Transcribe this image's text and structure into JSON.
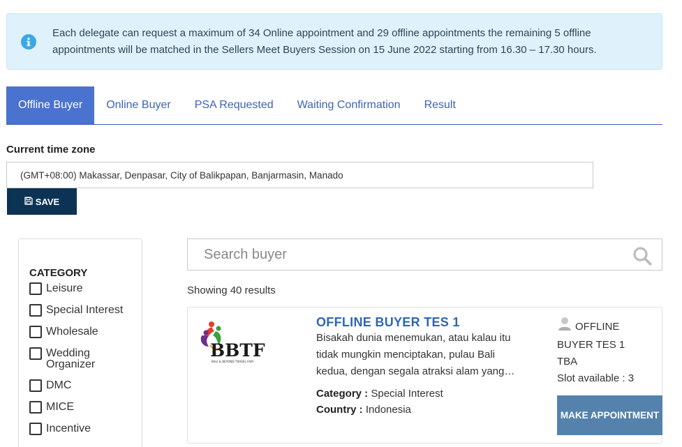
{
  "notice": {
    "icon": "info-icon",
    "text": "Each delegate can request a maximum of 34 Online appointment and 29 offline appointments the remaining 5 offline appointments will be matched in the Sellers Meet Buyers Session on 15 June 2022 starting from 16.30 – 17.30 hours."
  },
  "tabs": [
    {
      "label": "Offline Buyer",
      "active": true
    },
    {
      "label": "Online Buyer"
    },
    {
      "label": "PSA Requested"
    },
    {
      "label": "Waiting Confirmation"
    },
    {
      "label": "Result"
    }
  ],
  "timezone": {
    "label": "Current time zone",
    "value": "(GMT+08:00) Makassar, Denpasar, City of Balikpapan, Banjarmasin, Manado",
    "save_label": "SAVE"
  },
  "filter": {
    "title": "CATEGORY",
    "categories": [
      "Leisure",
      "Special Interest",
      "Wholesale",
      "Wedding Organizer",
      "DMC",
      "MICE",
      "Incentive"
    ]
  },
  "search": {
    "placeholder": "Search buyer",
    "results_text": "Showing 40 results"
  },
  "buyers": [
    {
      "logo_text": "BBTF",
      "logo_subtext": "BALI & BEYOND TRAVEL FAIR",
      "name": "OFFLINE BUYER TES 1",
      "description": "Bisakah dunia menemukan, atau kalau itu tidak mungkin menciptakan, pulau Bali kedua, dengan segala atraksi alam yang…",
      "category_label": "Category :",
      "category": "Special Interest",
      "country_label": "Country :",
      "country": "Indonesia",
      "contact_name": "OFFLINE BUYER TES 1",
      "contact_role": "TBA",
      "slot_text": "Slot available : 3",
      "button_label": "MAKE APPOINTMENT"
    }
  ],
  "colors": {
    "accent": "#4a72cf",
    "save_button": "#0c3354",
    "appointment_button": "#5482ac",
    "notice_bg": "#dff1fb"
  }
}
